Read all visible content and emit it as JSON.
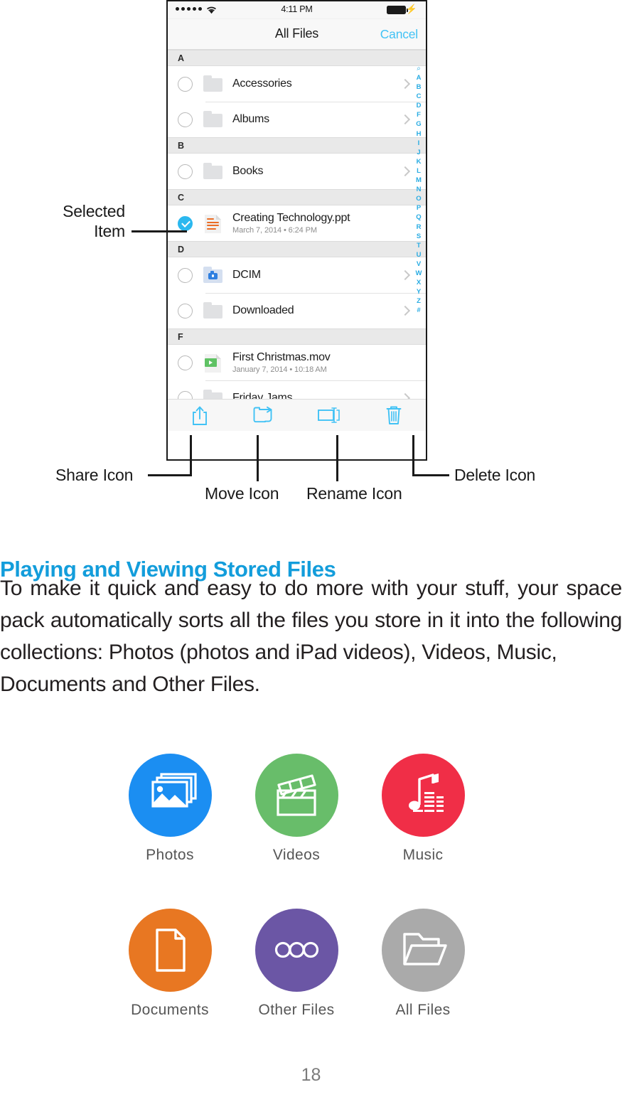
{
  "phone": {
    "status_bar": {
      "carrier_dots": 5,
      "wifi_icon": "wifi-icon",
      "time": "4:11 PM",
      "battery_icon": "battery-full-icon",
      "charging_icon": "lightning-bolt-icon"
    },
    "nav": {
      "title": "All Files",
      "cancel_label": "Cancel",
      "cancel_color": "#41c2f5"
    },
    "sections": [
      {
        "letter": "A",
        "rows": [
          {
            "name": "Accessories",
            "meta": "",
            "icon": "folder-icon",
            "type": "folder",
            "selected": false,
            "chevron": true
          },
          {
            "name": "Albums",
            "meta": "",
            "icon": "folder-icon",
            "type": "folder",
            "selected": false,
            "chevron": true
          }
        ]
      },
      {
        "letter": "B",
        "rows": [
          {
            "name": "Books",
            "meta": "",
            "icon": "folder-icon",
            "type": "folder",
            "selected": false,
            "chevron": true
          }
        ]
      },
      {
        "letter": "C",
        "rows": [
          {
            "name": "Creating Technology.ppt",
            "meta": "March 7, 2014 • 6:24 PM",
            "icon": "powerpoint-file-icon",
            "type": "file",
            "selected": true,
            "chevron": false
          }
        ]
      },
      {
        "letter": "D",
        "rows": [
          {
            "name": "DCIM",
            "meta": "",
            "icon": "camera-folder-icon",
            "type": "camera-folder",
            "selected": false,
            "chevron": true
          },
          {
            "name": "Downloaded",
            "meta": "",
            "icon": "folder-icon",
            "type": "folder",
            "selected": false,
            "chevron": true
          }
        ]
      },
      {
        "letter": "F",
        "rows": [
          {
            "name": "First Christmas.mov",
            "meta": "January 7, 2014 • 10:18 AM",
            "icon": "video-file-icon",
            "type": "file",
            "selected": false,
            "chevron": false
          },
          {
            "name": "Friday Jams",
            "meta": "",
            "icon": "folder-icon",
            "type": "folder",
            "selected": false,
            "chevron": true
          }
        ]
      }
    ],
    "index_scrubber": {
      "search_glyph": "⌕",
      "letters": [
        "A",
        "B",
        "C",
        "D",
        "F",
        "G",
        "H",
        "I",
        "J",
        "K",
        "L",
        "M",
        "N",
        "O",
        "P",
        "Q",
        "R",
        "S",
        "T",
        "U",
        "V",
        "W",
        "X",
        "Y",
        "Z",
        "#"
      ],
      "color": "#29ace3"
    },
    "toolbar": {
      "accent": "#41c2f5",
      "buttons": [
        {
          "name": "share-icon",
          "label": "Share"
        },
        {
          "name": "move-icon",
          "label": "Move"
        },
        {
          "name": "rename-icon",
          "label": "Rename"
        },
        {
          "name": "delete-icon",
          "label": "Delete"
        }
      ]
    }
  },
  "annotations": {
    "selected_item": "Selected\nItem",
    "selected_item_line1": "Selected",
    "selected_item_line2": "Item",
    "share": "Share Icon",
    "move": "Move Icon",
    "rename": "Rename Icon",
    "delete": "Delete Icon"
  },
  "article": {
    "heading": "Playing and Viewing Stored Files",
    "heading_color": "#139ddb",
    "body_justified": "To make it quick and easy to do more with your stuff, your space pack automatically sorts all the files you store in it into the following collections: Photos (photos and iPad videos), Videos, Music,",
    "body_last_line": "Documents and Other Files."
  },
  "collections": [
    {
      "label": "Photos",
      "color": "#1b8ef2",
      "icon": "photos-icon"
    },
    {
      "label": "Videos",
      "color": "#68bd6a",
      "icon": "clapperboard-icon"
    },
    {
      "label": "Music",
      "color": "#f02e47",
      "icon": "music-note-icon"
    },
    {
      "label": "Documents",
      "color": "#e87722",
      "icon": "document-icon"
    },
    {
      "label": "Other Files",
      "color": "#6b56a5",
      "icon": "ellipsis-icon"
    },
    {
      "label": "All Files",
      "color": "#aaaaaa",
      "icon": "open-folder-icon"
    }
  ],
  "page_number": "18"
}
